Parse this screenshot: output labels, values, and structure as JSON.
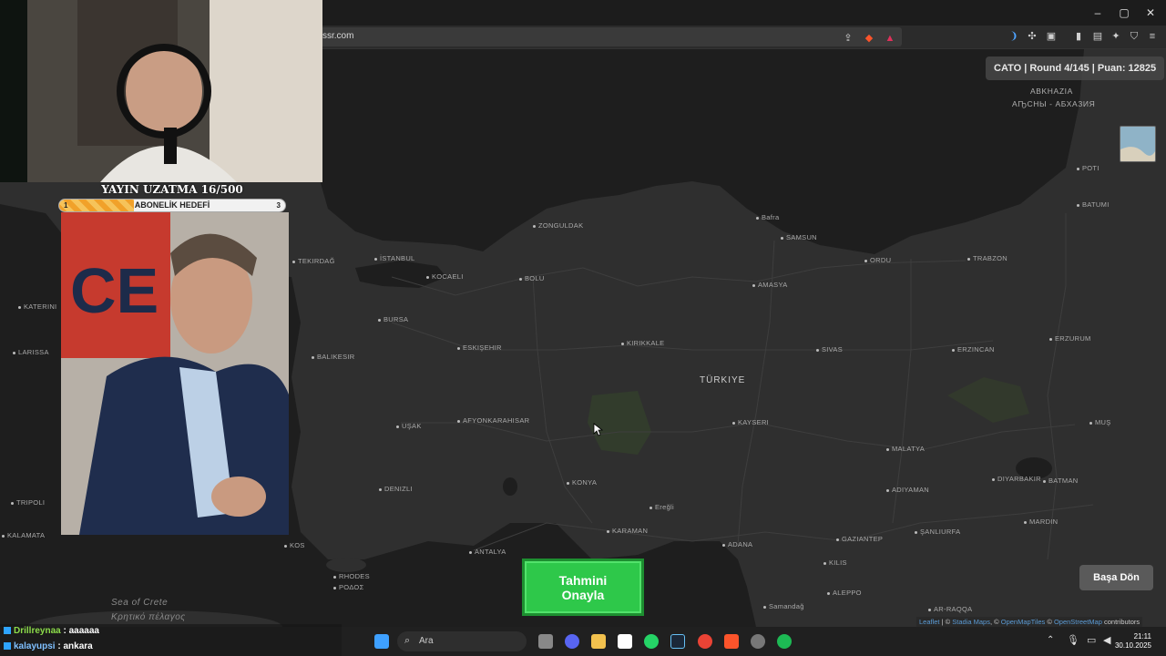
{
  "browser": {
    "url": "ssr.com",
    "window_controls": {
      "minimize": "–",
      "maximize": "▢",
      "close": "✕"
    }
  },
  "game": {
    "score_line": "CATO | Round 4/145 | Puan: 12825",
    "confirm_line1": "Tahmini",
    "confirm_line2": "Onayla",
    "back_button": "Başa Dön",
    "country_label": "TÜRKIYE",
    "attribution": {
      "leaflet": "Leaflet",
      "sep1": " | © ",
      "stadia": "Stadia Maps",
      "sep2": ", © ",
      "omt": "OpenMapTiles",
      "sep3": " © ",
      "osm": "OpenStreetMap",
      "tail": " contributors"
    }
  },
  "map_labels": {
    "cities": [
      {
        "id": "zonguldak",
        "name": "ZONGULDAK"
      },
      {
        "id": "bafra",
        "name": "Bafra"
      },
      {
        "id": "samsun",
        "name": "SAMSUN"
      },
      {
        "id": "ordu",
        "name": "ORDU"
      },
      {
        "id": "trabzon",
        "name": "TRABZON"
      },
      {
        "id": "tekirdag",
        "name": "TEKIRDAĞ"
      },
      {
        "id": "istanbul",
        "name": "İSTANBUL"
      },
      {
        "id": "kocaeli",
        "name": "KOCAELI"
      },
      {
        "id": "bolu",
        "name": "BOLU"
      },
      {
        "id": "amasya",
        "name": "AMASYA"
      },
      {
        "id": "bursa",
        "name": "BURSA"
      },
      {
        "id": "eskisehir",
        "name": "ESKIŞEHIR"
      },
      {
        "id": "kirikkale",
        "name": "KIRIKKALE"
      },
      {
        "id": "sivas",
        "name": "SIVAS"
      },
      {
        "id": "erzincan",
        "name": "ERZINCAN"
      },
      {
        "id": "erzurum",
        "name": "ERZURUM"
      },
      {
        "id": "balikesir",
        "name": "BALIKESIR"
      },
      {
        "id": "usak",
        "name": "UŞAK"
      },
      {
        "id": "afyon",
        "name": "AFYONKARAHISAR"
      },
      {
        "id": "kayseri",
        "name": "KAYSERI"
      },
      {
        "id": "mus",
        "name": "MUŞ"
      },
      {
        "id": "malatya",
        "name": "MALATYA"
      },
      {
        "id": "denizli",
        "name": "DENIZLI"
      },
      {
        "id": "konya",
        "name": "KONYA"
      },
      {
        "id": "eregli",
        "name": "Ereğli"
      },
      {
        "id": "diyarbakir",
        "name": "DIYARBAKIR"
      },
      {
        "id": "batman",
        "name": "BATMAN"
      },
      {
        "id": "adiyaman",
        "name": "ADIYAMAN"
      },
      {
        "id": "karaman",
        "name": "KARAMAN"
      },
      {
        "id": "adana",
        "name": "ADANA"
      },
      {
        "id": "sanliurfa",
        "name": "ŞANLIURFA"
      },
      {
        "id": "mardin",
        "name": "MARDIN"
      },
      {
        "id": "antalya",
        "name": "ANTALYA"
      },
      {
        "id": "gaziantep",
        "name": "GAZIANTEP"
      },
      {
        "id": "kilis",
        "name": "KILIS"
      },
      {
        "id": "aleppo",
        "name": "ALEPPO"
      },
      {
        "id": "samandag",
        "name": "Samandağ"
      },
      {
        "id": "rhodes",
        "name": "RHODES"
      },
      {
        "id": "rodos",
        "name": "ΡΟΔΟΣ"
      },
      {
        "id": "poti",
        "name": "POTI"
      },
      {
        "id": "batumi",
        "name": "BATUMI"
      },
      {
        "id": "ar-raqqa",
        "name": "AR-RAQQA"
      },
      {
        "id": "kos",
        "name": "KOS"
      },
      {
        "id": "katerini",
        "name": "KATERINI"
      },
      {
        "id": "larissa",
        "name": "LARISSA"
      },
      {
        "id": "tripoli",
        "name": "TRIPOLI"
      },
      {
        "id": "kalamata",
        "name": "KALAMATA"
      }
    ],
    "region_abkhazia": "ABKHAZIA",
    "region_abkhazia_local": "АҦСНЫ - АБХАЗИЯ",
    "sea_crete": "Sea of Crete",
    "sea_crete_greek": "Κρητικό πέλαγος"
  },
  "stream_overlay": {
    "uzatma": "YAYIN UZATMA 16/500",
    "goal_label": "ABONELİK HEDEFİ",
    "goal_min": "1",
    "goal_max": "3",
    "goal_progress": 0.33
  },
  "chat": [
    {
      "user": "Drillreynaa",
      "message": ": aaaaaa"
    },
    {
      "user": "kalayupsi",
      "message": ": ankara"
    }
  ],
  "taskbar": {
    "search_placeholder": "Ara",
    "time": "21:11",
    "date": "30.10.2025"
  },
  "colors": {
    "confirm": "#2ec84a",
    "map_bg": "#2f2f2f",
    "sea": "#1e1e1e"
  }
}
